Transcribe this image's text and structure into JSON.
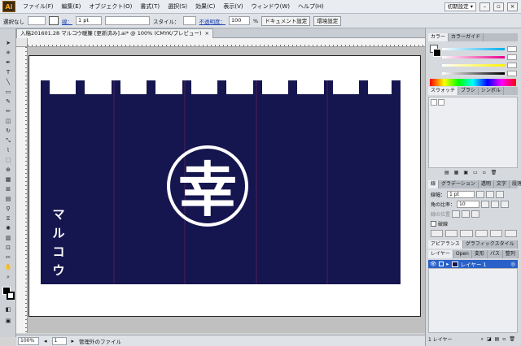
{
  "app": {
    "logo": "Ai"
  },
  "menubar": {
    "items": [
      "ファイル(F)",
      "編集(E)",
      "オブジェクト(O)",
      "書式(T)",
      "選択(S)",
      "効果(C)",
      "表示(V)",
      "ウィンドウ(W)",
      "ヘルプ(H)"
    ],
    "workspace": "初期設定 ▾",
    "window_buttons": [
      "–",
      "▫",
      "×"
    ]
  },
  "controlbar": {
    "selection": "選択なし",
    "stroke_label": "線：",
    "stroke_weight": "1 pt",
    "style_label": "スタイル：",
    "opacity_label": "不透明度：",
    "opacity_value": "100",
    "opacity_unit": "%",
    "doc_setup": "ドキュメント設定",
    "prefs": "環境設定"
  },
  "document": {
    "tab_title": "入稿201601.28 マルコウ暖簾 [更新済み].ai* @ 100% (CMYK/プレビュー)",
    "tab_close": "×"
  },
  "artwork": {
    "kanji": "幸",
    "vertical_text": [
      "マ",
      "ル",
      "コ",
      "ウ"
    ],
    "noren_color": "#15154f"
  },
  "statusbar": {
    "zoom": "100%",
    "page": "1",
    "info": "管理外のファイル"
  },
  "panels": {
    "color_tabs": [
      "カラー",
      "カラーガイド"
    ],
    "swatch_tabs": [
      "スウォッチ",
      "ブラシ",
      "シンボル"
    ],
    "stroke_tabs": [
      "線",
      "グラデーション",
      "透明",
      "文字",
      "段落"
    ],
    "stroke_weight_label": "線幅：",
    "stroke_weight_value": "1 pt",
    "miter_label": "角の比率：",
    "miter_value": "10",
    "align_label": "線の位置",
    "dashed_label": "破線",
    "appearance_tabs": [
      "アピアランス",
      "グラフィックスタイル"
    ],
    "layer_tabs": [
      "レイヤー",
      "Open",
      "変形",
      "パス",
      "整列"
    ],
    "layer_name": "レイヤー 1",
    "layer_count": "1 レイヤー"
  }
}
